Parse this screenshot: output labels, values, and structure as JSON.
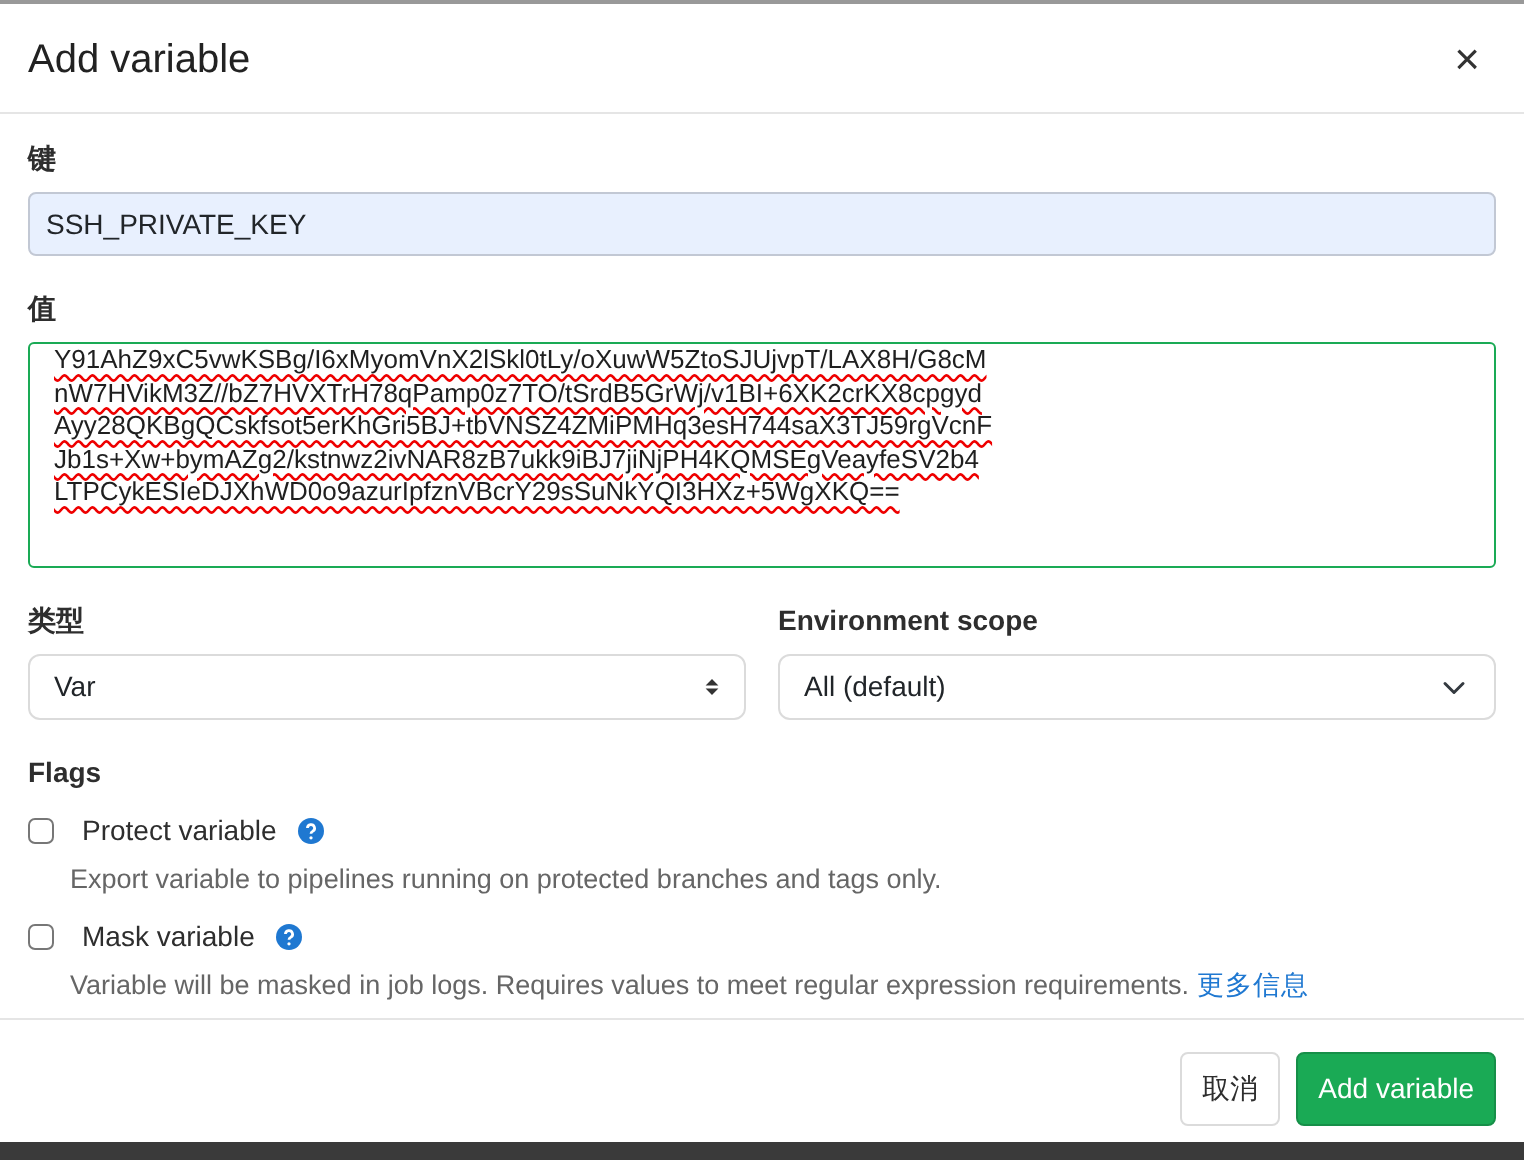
{
  "dialog": {
    "title": "Add variable",
    "close": "×"
  },
  "key_field": {
    "label": "键",
    "value": "SSH_PRIVATE_KEY"
  },
  "value_field": {
    "label": "值",
    "lines": [
      "Y91AhZ9xC5vwKSBg/I6xMyomVnX2lSkl0tLy/oXuwW5ZtoSJUjvpT/LAX8H/G8cM",
      "nW7HVikM3Z//bZ7HVXTrH78qPamp0z7TO/tSrdB5GrWj/v1BI+6XK2crKX8cpgyd",
      "Ayy28QKBgQCskfsot5erKhGri5BJ+tbVNSZ4ZMiPMHq3esH744saX3TJ59rgVcnF",
      "Jb1s+Xw+bymAZg2/kstnwz2ivNAR8zB7ukk9iBJ7jiNjPH4KQMSEgVeayfeSV2b4",
      "LTPCykESIeDJXhWD0o9azurIpfznVBcrY29sSuNkYQI3HXz+5WgXKQ=="
    ]
  },
  "type_field": {
    "label": "类型",
    "value": "Var"
  },
  "scope_field": {
    "label": "Environment scope",
    "value": "All (default)"
  },
  "flags": {
    "label": "Flags",
    "items": [
      {
        "label": "Protect variable",
        "checked": false,
        "help": "Export variable to pipelines running on protected branches and tags only."
      },
      {
        "label": "Mask variable",
        "checked": false,
        "help": "Variable will be masked in job logs. Requires values to meet regular expression requirements.",
        "link": "更多信息"
      }
    ]
  },
  "buttons": [
    {
      "label": "取消",
      "kind": "secondary"
    },
    {
      "label": "Add variable",
      "kind": "primary"
    }
  ]
}
